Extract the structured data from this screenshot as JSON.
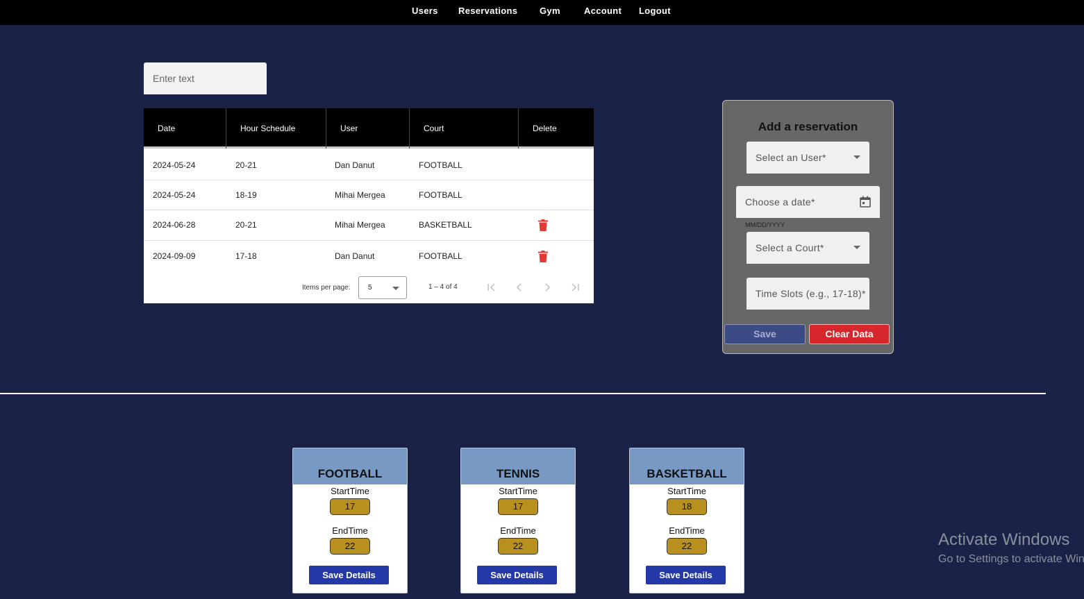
{
  "nav": {
    "items": [
      "Users",
      "Reservations",
      "Gym",
      "Account",
      "Logout"
    ]
  },
  "search": {
    "placeholder": "Enter text"
  },
  "table": {
    "headers": [
      "Date",
      "Hour Schedule",
      "User",
      "Court",
      "Delete"
    ],
    "rows": [
      {
        "date": "2024-05-24",
        "hours": "20-21",
        "user": "Dan Danut",
        "court": "FOOTBALL",
        "deletable": false
      },
      {
        "date": "2024-05-24",
        "hours": "18-19",
        "user": "Mihai Mergea",
        "court": "FOOTBALL",
        "deletable": false
      },
      {
        "date": "2024-06-28",
        "hours": "20-21",
        "user": "Mihai Mergea",
        "court": "BASKETBALL",
        "deletable": true
      },
      {
        "date": "2024-09-09",
        "hours": "17-18",
        "user": "Dan Danut",
        "court": "FOOTBALL",
        "deletable": true
      }
    ],
    "paginator": {
      "items_per_page_label": "Items per page:",
      "items_per_page": "5",
      "range": "1 – 4 of 4"
    },
    "delete_icon": "trash-icon",
    "delete_color": "#e53935"
  },
  "form": {
    "title": "Add a reservation",
    "user_label": "Select an User*",
    "date_label": "Choose a date*",
    "date_hint": "MM/DD/YYYY",
    "court_label": "Select a Court*",
    "slots_label": "Time Slots (e.g., 17-18)*",
    "save_label": "Save",
    "clear_label": "Clear Data"
  },
  "courts": [
    {
      "name": "FOOTBALL",
      "start_label": "StartTime",
      "start": "17",
      "end_label": "EndTime",
      "end": "22",
      "button": "Save Details"
    },
    {
      "name": "TENNIS",
      "start_label": "StartTime",
      "start": "17",
      "end_label": "EndTime",
      "end": "22",
      "button": "Save Details"
    },
    {
      "name": "BASKETBALL",
      "start_label": "StartTime",
      "start": "18",
      "end_label": "EndTime",
      "end": "22",
      "button": "Save Details"
    }
  ],
  "watermark": {
    "title": "Activate Windows",
    "subtitle": "Go to Settings to activate Windows."
  },
  "colors": {
    "background": "#1a2248",
    "nav": "#000000",
    "court_header": "#7899c4",
    "time_badge": "#b8901f",
    "save_details": "#2438a8",
    "clear": "#d7262c"
  }
}
